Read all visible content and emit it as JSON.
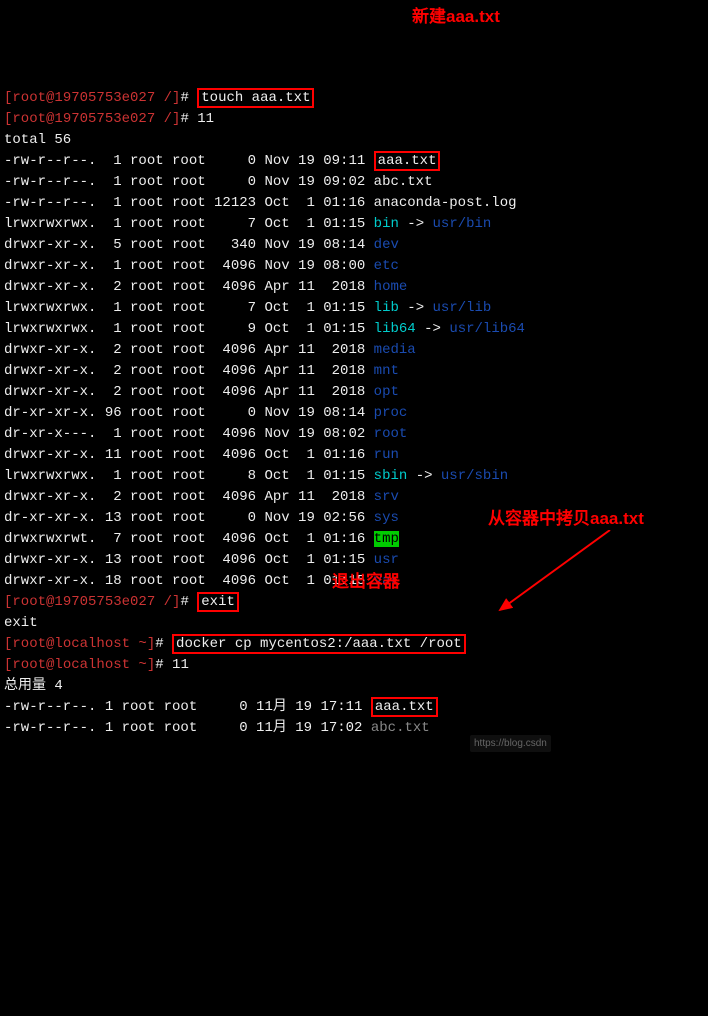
{
  "prompt1_user": "[root@19705753e027 /]# ",
  "cmd1": "touch aaa.txt",
  "annot1": "新建aaa.txt",
  "prompt2": "[root@19705753e027 /]# 11",
  "total": "total 56",
  "ls": [
    {
      "perm": "-rw-r--r--.",
      "lnk": " 1",
      "own": "root root",
      "size": "    0",
      "date": "Nov 19 09:11",
      "name": "aaa.txt",
      "cls": "white",
      "box": true
    },
    {
      "perm": "-rw-r--r--.",
      "lnk": " 1",
      "own": "root root",
      "size": "    0",
      "date": "Nov 19 09:02",
      "name": "abc.txt",
      "cls": "white"
    },
    {
      "perm": "-rw-r--r--.",
      "lnk": " 1",
      "own": "root root",
      "size": "12123",
      "date": "Oct  1 01:16",
      "name": "anaconda-post.log",
      "cls": "white"
    },
    {
      "perm": "lrwxrwxrwx.",
      "lnk": " 1",
      "own": "root root",
      "size": "    7",
      "date": "Oct  1 01:15",
      "name": "bin",
      "cls": "cyan",
      "arrow": " -> ",
      "tgt": "usr/bin",
      "tcls": "darkblue"
    },
    {
      "perm": "drwxr-xr-x.",
      "lnk": " 5",
      "own": "root root",
      "size": "  340",
      "date": "Nov 19 08:14",
      "name": "dev",
      "cls": "darkblue"
    },
    {
      "perm": "drwxr-xr-x.",
      "lnk": " 1",
      "own": "root root",
      "size": " 4096",
      "date": "Nov 19 08:00",
      "name": "etc",
      "cls": "darkblue"
    },
    {
      "perm": "drwxr-xr-x.",
      "lnk": " 2",
      "own": "root root",
      "size": " 4096",
      "date": "Apr 11  2018",
      "name": "home",
      "cls": "darkblue"
    },
    {
      "perm": "lrwxrwxrwx.",
      "lnk": " 1",
      "own": "root root",
      "size": "    7",
      "date": "Oct  1 01:15",
      "name": "lib",
      "cls": "cyan",
      "arrow": " -> ",
      "tgt": "usr/lib",
      "tcls": "darkblue"
    },
    {
      "perm": "lrwxrwxrwx.",
      "lnk": " 1",
      "own": "root root",
      "size": "    9",
      "date": "Oct  1 01:15",
      "name": "lib64",
      "cls": "cyan",
      "arrow": " -> ",
      "tgt": "usr/lib64",
      "tcls": "darkblue"
    },
    {
      "perm": "drwxr-xr-x.",
      "lnk": " 2",
      "own": "root root",
      "size": " 4096",
      "date": "Apr 11  2018",
      "name": "media",
      "cls": "darkblue"
    },
    {
      "perm": "drwxr-xr-x.",
      "lnk": " 2",
      "own": "root root",
      "size": " 4096",
      "date": "Apr 11  2018",
      "name": "mnt",
      "cls": "darkblue"
    },
    {
      "perm": "drwxr-xr-x.",
      "lnk": " 2",
      "own": "root root",
      "size": " 4096",
      "date": "Apr 11  2018",
      "name": "opt",
      "cls": "darkblue"
    },
    {
      "perm": "dr-xr-xr-x.",
      "lnk": "96",
      "own": "root root",
      "size": "    0",
      "date": "Nov 19 08:14",
      "name": "proc",
      "cls": "darkblue"
    },
    {
      "perm": "dr-xr-x---.",
      "lnk": " 1",
      "own": "root root",
      "size": " 4096",
      "date": "Nov 19 08:02",
      "name": "root",
      "cls": "darkblue"
    },
    {
      "perm": "drwxr-xr-x.",
      "lnk": "11",
      "own": "root root",
      "size": " 4096",
      "date": "Oct  1 01:16",
      "name": "run",
      "cls": "darkblue"
    },
    {
      "perm": "lrwxrwxrwx.",
      "lnk": " 1",
      "own": "root root",
      "size": "    8",
      "date": "Oct  1 01:15",
      "name": "sbin",
      "cls": "cyan",
      "arrow": " -> ",
      "tgt": "usr/sbin",
      "tcls": "darkblue"
    },
    {
      "perm": "drwxr-xr-x.",
      "lnk": " 2",
      "own": "root root",
      "size": " 4096",
      "date": "Apr 11  2018",
      "name": "srv",
      "cls": "darkblue"
    },
    {
      "perm": "dr-xr-xr-x.",
      "lnk": "13",
      "own": "root root",
      "size": "    0",
      "date": "Nov 19 02:56",
      "name": "sys",
      "cls": "darkblue"
    },
    {
      "perm": "drwxrwxrwt.",
      "lnk": " 7",
      "own": "root root",
      "size": " 4096",
      "date": "Oct  1 01:16",
      "name": "tmp",
      "cls": "bg-green"
    },
    {
      "perm": "drwxr-xr-x.",
      "lnk": "13",
      "own": "root root",
      "size": " 4096",
      "date": "Oct  1 01:15",
      "name": "usr",
      "cls": "darkblue"
    },
    {
      "perm": "drwxr-xr-x.",
      "lnk": "18",
      "own": "root root",
      "size": " 4096",
      "date": "Oct  1 01:15",
      "name": "var",
      "cls": "darkblue"
    }
  ],
  "prompt3": "[root@19705753e027 /]# ",
  "cmd3": "exit",
  "annot3": "退出容器",
  "exit_out": "exit",
  "prompt4": "[root@localhost ~]# ",
  "cmd4": "docker cp mycentos2:/aaa.txt /root",
  "annot4": "从容器中拷贝aaa.txt",
  "prompt5": "[root@localhost ~]# 11",
  "total2": "总用量 4",
  "ls2": [
    {
      "perm": "-rw-r--r--.",
      "lnk": "1",
      "own": "root root",
      "size": "    0",
      "date": "11月 19 17:11",
      "name": "aaa.txt",
      "cls": "white",
      "box": true
    },
    {
      "perm": "-rw-r--r--.",
      "lnk": "1",
      "own": "root root",
      "size": "    0",
      "date": "11月 19 17:02",
      "name": "abc.txt",
      "cls": "dim"
    }
  ],
  "watermark": "https://blog.csdn"
}
